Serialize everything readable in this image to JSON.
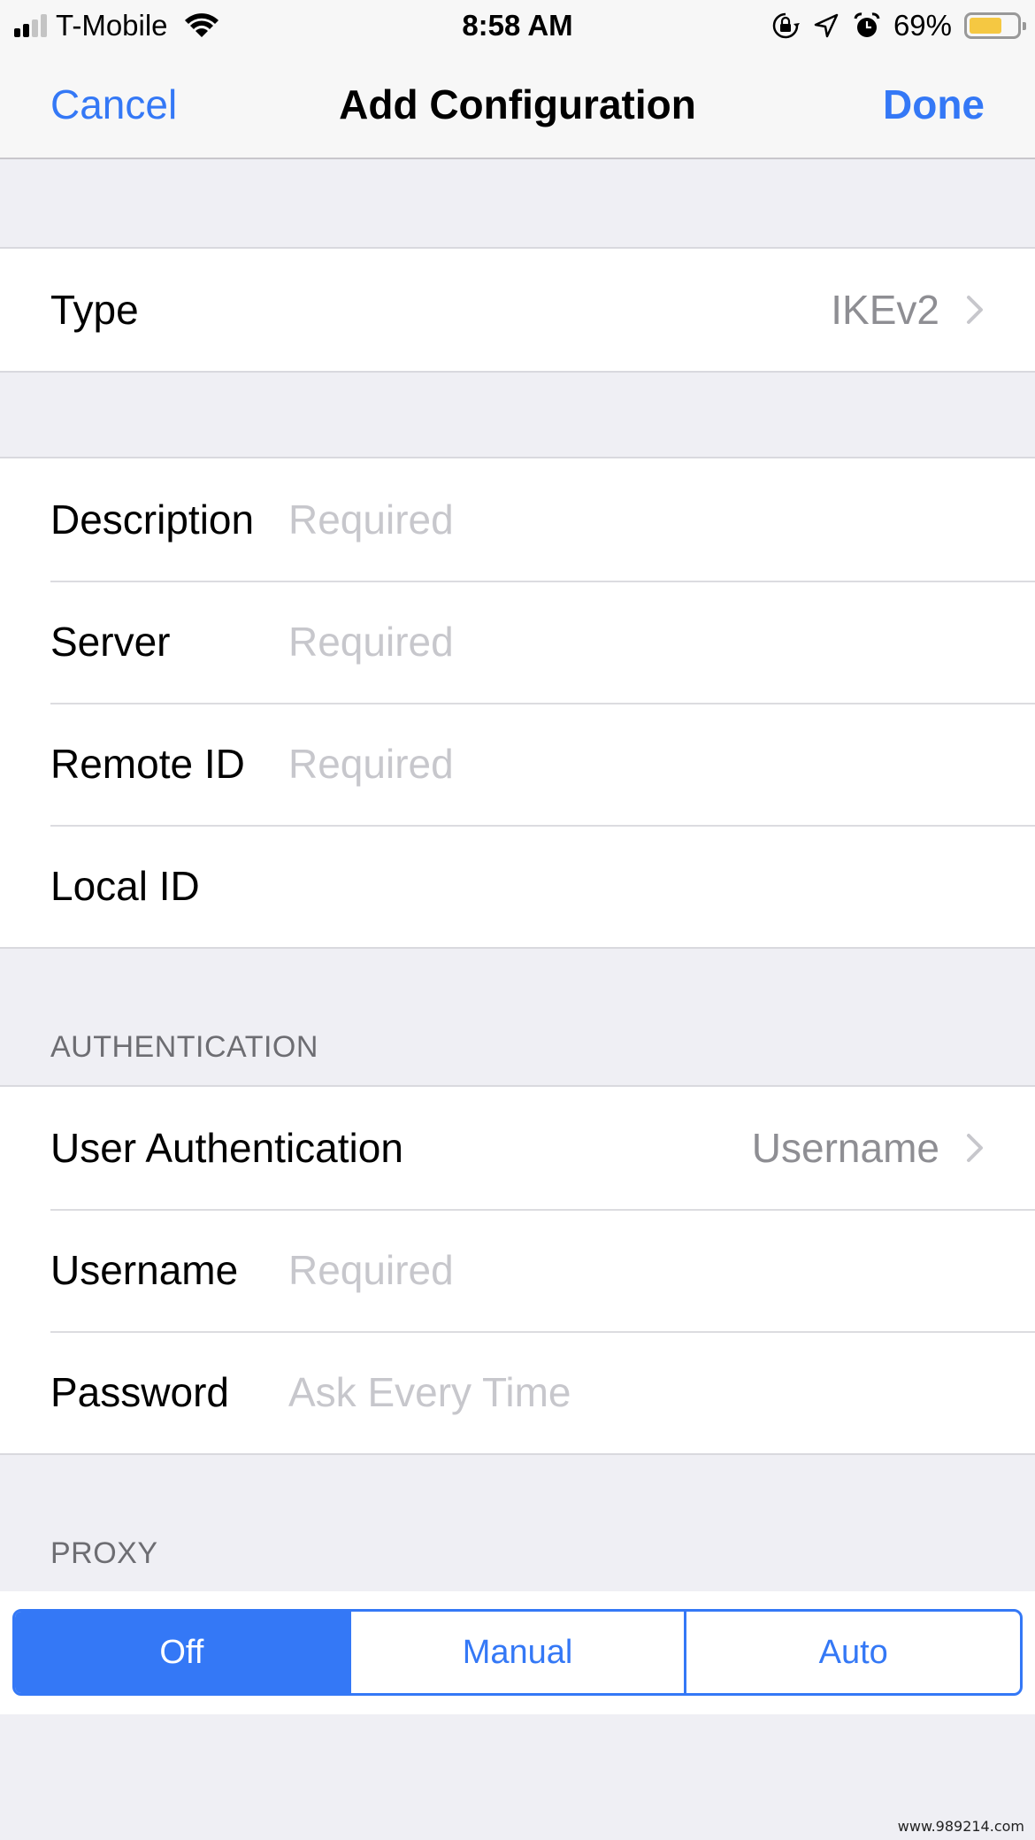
{
  "status_bar": {
    "carrier": "T-Mobile",
    "signal_bars_filled": 2,
    "signal_bars_total": 4,
    "time": "8:58 AM",
    "icons": [
      "orientation-lock-icon",
      "location-icon",
      "alarm-icon"
    ],
    "battery_percent_label": "69%",
    "battery_level": 0.69,
    "battery_color": "#f5c842"
  },
  "navbar": {
    "cancel_label": "Cancel",
    "title": "Add Configuration",
    "done_label": "Done",
    "accent_color": "#3478f6"
  },
  "type_section": {
    "label": "Type",
    "value": "IKEv2"
  },
  "general_section": {
    "rows": [
      {
        "label": "Description",
        "value": "",
        "placeholder": "Required"
      },
      {
        "label": "Server",
        "value": "",
        "placeholder": "Required"
      },
      {
        "label": "Remote ID",
        "value": "",
        "placeholder": "Required"
      },
      {
        "label": "Local ID",
        "value": "",
        "placeholder": ""
      }
    ]
  },
  "authentication_section": {
    "header": "AUTHENTICATION",
    "user_auth": {
      "label": "User Authentication",
      "value": "Username"
    },
    "rows": [
      {
        "label": "Username",
        "value": "",
        "placeholder": "Required"
      },
      {
        "label": "Password",
        "value": "",
        "placeholder": "Ask Every Time"
      }
    ]
  },
  "proxy_section": {
    "header": "PROXY",
    "options": [
      "Off",
      "Manual",
      "Auto"
    ],
    "selected": "Off"
  },
  "watermark": "www.989214.com"
}
